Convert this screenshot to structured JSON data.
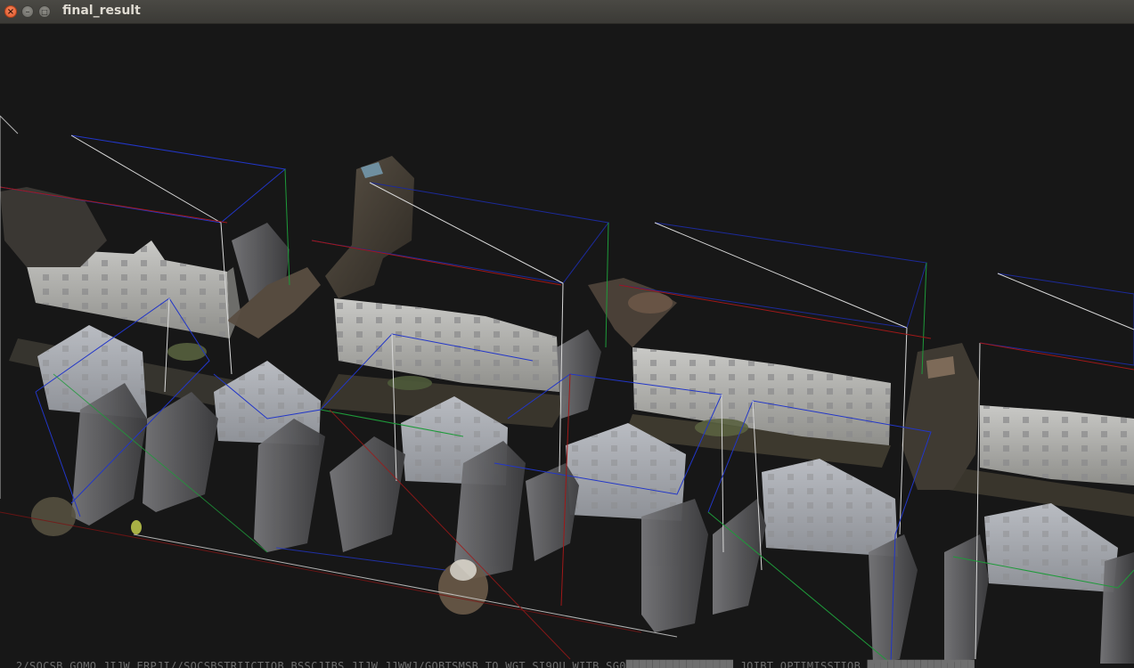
{
  "window": {
    "title": "final_result",
    "close_icon": "×",
    "minimize_icon": "–",
    "maximize_icon": "□"
  },
  "viewport": {
    "background": "#171717",
    "content": "3d-point-cloud-reconstruction"
  },
  "console": {
    "text": "2/SOCSB_GOMO_JIJW_ERPJI//SOCSBSTRIICTIOB_BSSCJIBS_JIJW_JJWWJ/GOBTSMSB_TO_WGT_SI9OU_WITB_SG0████████████████  JOIBT_OPTIMISSTIOB ████████████████"
  },
  "colors": {
    "titlebar": "#3d3c38",
    "title_text": "#dfdbd2",
    "close_button": "#e95e2c",
    "frustum_blue": "#1f2bd0",
    "frustum_white": "#e6e6e6",
    "frustum_green": "#1e9a3a",
    "frustum_red": "#a01818"
  }
}
